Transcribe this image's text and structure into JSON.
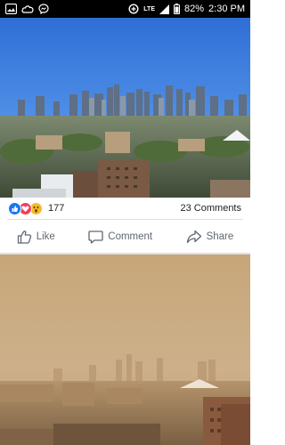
{
  "status_bar": {
    "network": "LTE",
    "battery": "82%",
    "time": "2:30 PM",
    "left_icons": [
      "gallery-icon",
      "cloud-icon",
      "messenger-icon"
    ],
    "right_icons": [
      "data-saver-icon",
      "signal-icon",
      "battery-icon"
    ]
  },
  "post": {
    "reactions": {
      "icons": [
        "like-reaction",
        "love-reaction",
        "wow-reaction"
      ],
      "count": "177"
    },
    "comments": "23 Comments",
    "actions": {
      "like": "Like",
      "comment": "Comment",
      "share": "Share"
    }
  },
  "colors": {
    "like_blue": "#1877f2",
    "love_red": "#f33e58",
    "wow_yellow": "#f7b928",
    "action_gray": "#606770"
  }
}
